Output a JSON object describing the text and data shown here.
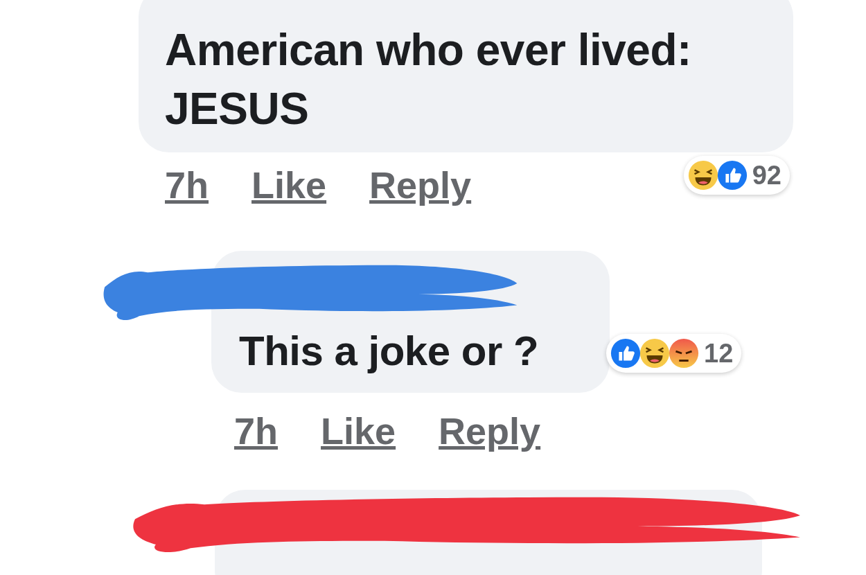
{
  "comments": [
    {
      "text_lines": [
        "American who ever lived:",
        "JESUS"
      ],
      "time": "7h",
      "like": "Like",
      "reply": "Reply",
      "reactions": [
        {
          "kind": "haha"
        },
        {
          "kind": "like"
        }
      ],
      "reaction_count": "92"
    },
    {
      "redaction": {
        "color": "#3b82e0"
      },
      "text_lines": [
        "This a joke or ?"
      ],
      "time": "7h",
      "like": "Like",
      "reply": "Reply",
      "reactions": [
        {
          "kind": "like"
        },
        {
          "kind": "haha"
        },
        {
          "kind": "angry"
        }
      ],
      "reaction_count": "12"
    },
    {
      "redaction": {
        "color": "#ee3340"
      }
    }
  ]
}
